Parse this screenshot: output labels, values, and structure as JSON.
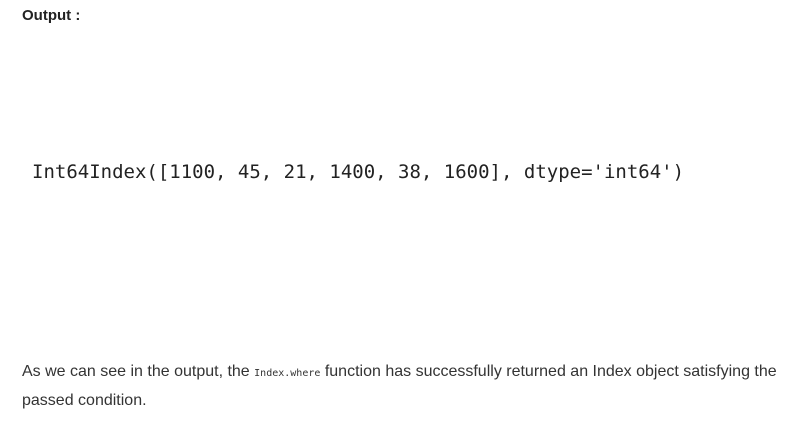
{
  "heading": "Output :",
  "output_text": "Int64Index([1100, 45, 21, 1400, 38, 1600], dtype='int64')",
  "paragraph": {
    "before": "As we can see in the output, the ",
    "code": "Index.where",
    "after": " function has successfully returned an Index object satisfying the passed condition."
  }
}
